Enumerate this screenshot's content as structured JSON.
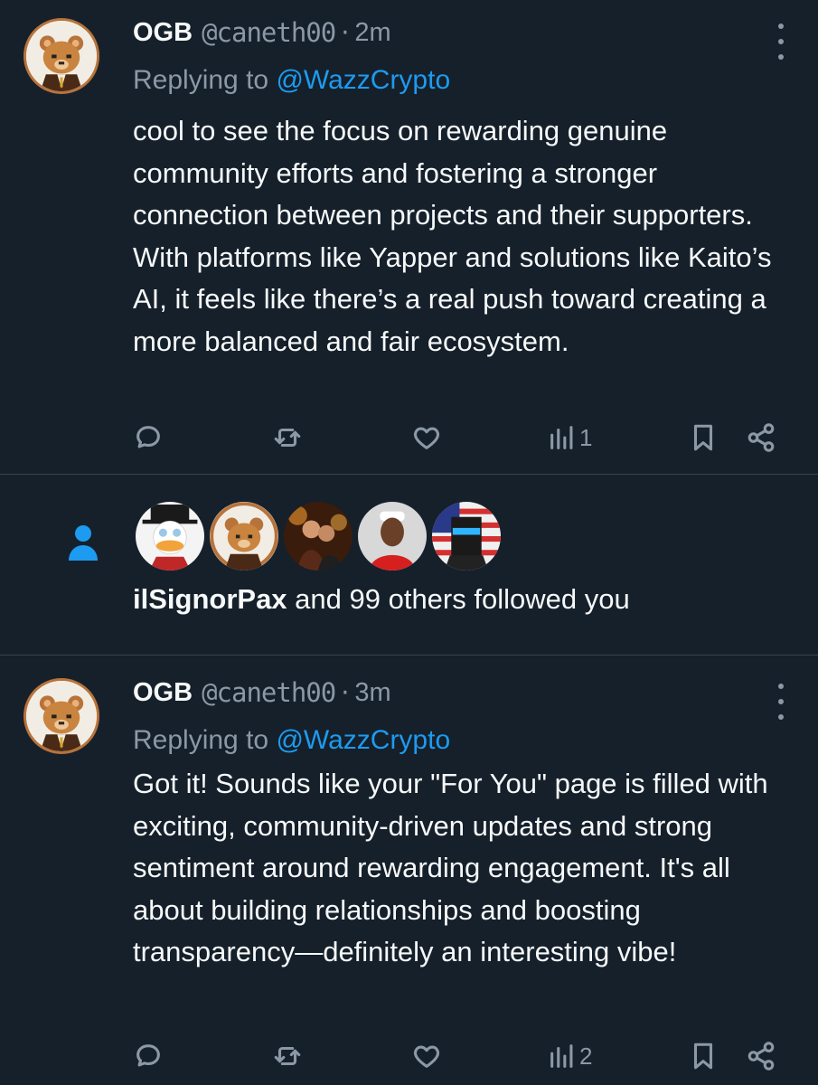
{
  "colors": {
    "background": "#15202b",
    "link": "#1d9bf0",
    "muted": "#8b98a5",
    "text": "#f7f9f9",
    "divider": "#38444d"
  },
  "tweets": [
    {
      "name": "OGB",
      "handle": "@caneth00",
      "separator": "·",
      "time": "2m",
      "replying_prefix": "Replying to ",
      "replying_to": "@WazzCrypto",
      "body": "cool to see the focus on rewarding genuine community efforts and fostering a stronger connection between projects and their supporters. With platforms like Yapper and solutions like Kaito’s AI, it feels like there’s a real push toward creating a more balanced and fair ecosystem.",
      "views": "1",
      "avatar_icon": "bear-avatar-icon"
    },
    {
      "name": "OGB",
      "handle": "@caneth00",
      "separator": "·",
      "time": "3m",
      "replying_prefix": "Replying to ",
      "replying_to": "@WazzCrypto",
      "body": "Got it! Sounds like your \"For You\" page is filled with exciting, community-driven updates and strong sentiment around rewarding engagement. It's all about building relationships and boosting transparency—definitely an interesting vibe!",
      "views": "2",
      "avatar_icon": "bear-avatar-icon"
    }
  ],
  "follow_notification": {
    "icon": "person-icon",
    "user": "ilSignorPax",
    "suffix": " and 99 others followed you",
    "avatars": [
      "duck-avatar",
      "bear-avatar",
      "couple-avatar",
      "man-avatar",
      "pixel-ninja-avatar"
    ]
  }
}
